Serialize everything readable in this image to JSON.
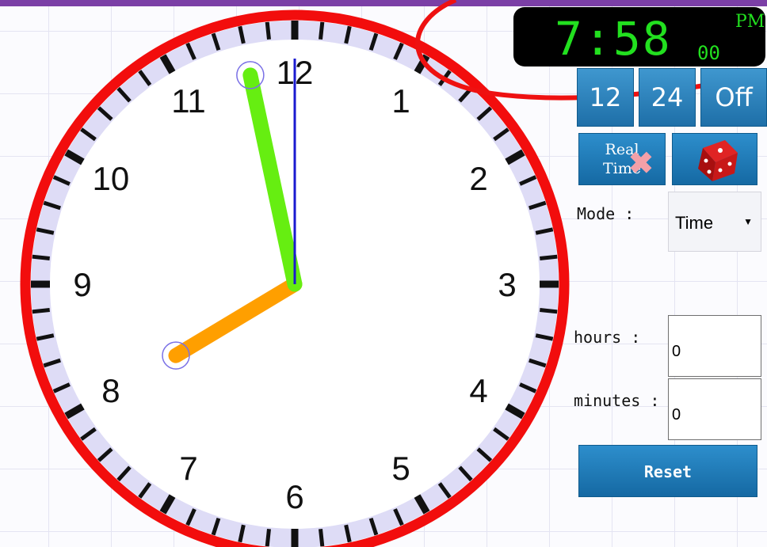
{
  "clock": {
    "numbers": [
      "12",
      "1",
      "2",
      "3",
      "4",
      "5",
      "6",
      "7",
      "8",
      "9",
      "10",
      "11"
    ],
    "colors": {
      "rim": "#f20d0d",
      "tick_ring": "#dedcf6",
      "hour_hand": "#ff9f00",
      "minute_hand": "#66ee11",
      "second_hand": "#1a1ad0"
    }
  },
  "digital": {
    "time": "7:58",
    "seconds": "00",
    "ampm": "PM"
  },
  "format_buttons": {
    "btn12": "12",
    "btn24": "24",
    "off": "Off"
  },
  "real_time": {
    "label_line1": "Real",
    "label_line2": "Time"
  },
  "dice": {
    "icon": "dice-icon"
  },
  "mode": {
    "label": "Mode :",
    "value": "Time"
  },
  "hours": {
    "label": "hours :",
    "value": "0"
  },
  "minutes": {
    "label": "minutes :",
    "value": "0"
  },
  "reset": {
    "label": "Reset"
  }
}
